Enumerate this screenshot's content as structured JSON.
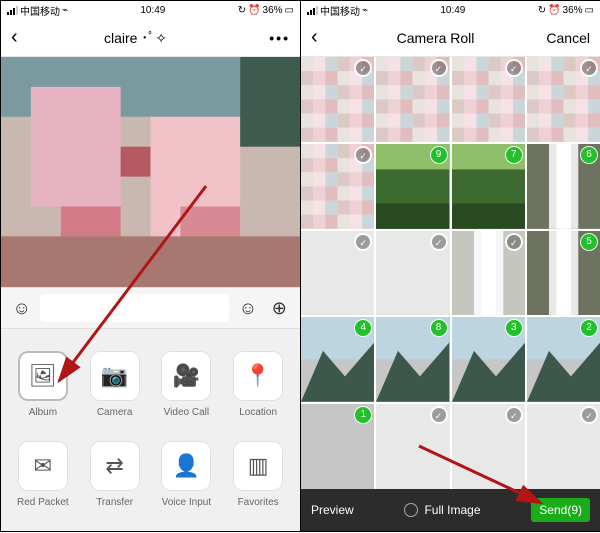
{
  "status": {
    "carrier": "中国移动",
    "time": "10:49",
    "battery": "36%",
    "alarm_icon": "⏰",
    "clock_icon": "↻"
  },
  "left": {
    "nav": {
      "back": "‹",
      "title": "claire ･ﾟ✧",
      "more": "•••"
    },
    "input": {
      "placeholder": ""
    },
    "panel": {
      "items": [
        {
          "label": "Album",
          "icon": "🖼"
        },
        {
          "label": "Camera",
          "icon": "📷"
        },
        {
          "label": "Video Call",
          "icon": "🎥"
        },
        {
          "label": "Location",
          "icon": "📍"
        },
        {
          "label": "Red Packet",
          "icon": "✉"
        },
        {
          "label": "Transfer",
          "icon": "⇄"
        },
        {
          "label": "Voice Input",
          "icon": "👤"
        },
        {
          "label": "Favorites",
          "icon": "▥"
        }
      ]
    }
  },
  "right": {
    "nav": {
      "back": "‹",
      "title": "Camera Roll",
      "cancel": "Cancel"
    },
    "grid": [
      {
        "selected": false,
        "kind": "pix"
      },
      {
        "selected": false,
        "kind": "pix"
      },
      {
        "selected": false,
        "kind": "pix"
      },
      {
        "selected": false,
        "kind": "pix"
      },
      {
        "selected": false,
        "kind": "pix"
      },
      {
        "selected": false,
        "number": 9,
        "kind": "green"
      },
      {
        "selected": false,
        "number": 7,
        "kind": "green"
      },
      {
        "selected": false,
        "number": 6,
        "kind": "fall"
      },
      {
        "selected": false,
        "kind": "gray"
      },
      {
        "selected": false,
        "kind": "gray"
      },
      {
        "selected": false,
        "kind": "fall"
      },
      {
        "selected": false,
        "number": 5,
        "kind": "fall"
      },
      {
        "selected": false,
        "number": 4,
        "kind": "mtn"
      },
      {
        "selected": false,
        "number": 8,
        "kind": "mtn"
      },
      {
        "selected": false,
        "number": 3,
        "kind": "mtn"
      },
      {
        "selected": false,
        "number": 2,
        "kind": "mtn"
      },
      {
        "selected": false,
        "number": 1,
        "kind": "gray"
      },
      {
        "selected": false,
        "kind": "gray"
      },
      {
        "selected": false,
        "kind": "gray"
      },
      {
        "selected": false,
        "kind": "gray"
      }
    ],
    "bottom": {
      "preview": "Preview",
      "full": "Full Image",
      "send": "Send(9)"
    }
  }
}
